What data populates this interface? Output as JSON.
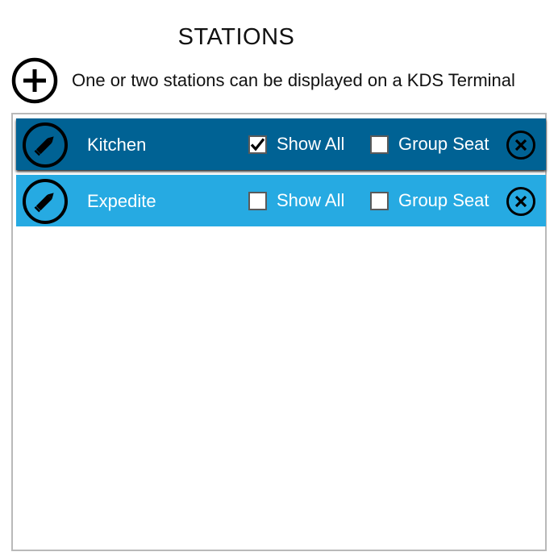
{
  "header": {
    "title": "STATIONS",
    "subtitle": "One or two stations can be displayed on a KDS Terminal"
  },
  "icons": {
    "add": "plus-circle-icon",
    "edit": "pencil-icon",
    "remove": "x-circle-icon"
  },
  "colors": {
    "selected_row": "#006294",
    "row": "#26aae2"
  },
  "stations": [
    {
      "name": "Kitchen",
      "show_all_label": "Show All",
      "show_all_checked": true,
      "group_seat_label": "Group Seat",
      "group_seat_checked": false,
      "selected": true
    },
    {
      "name": "Expedite",
      "show_all_label": "Show All",
      "show_all_checked": false,
      "group_seat_label": "Group Seat",
      "group_seat_checked": false,
      "selected": false
    }
  ]
}
